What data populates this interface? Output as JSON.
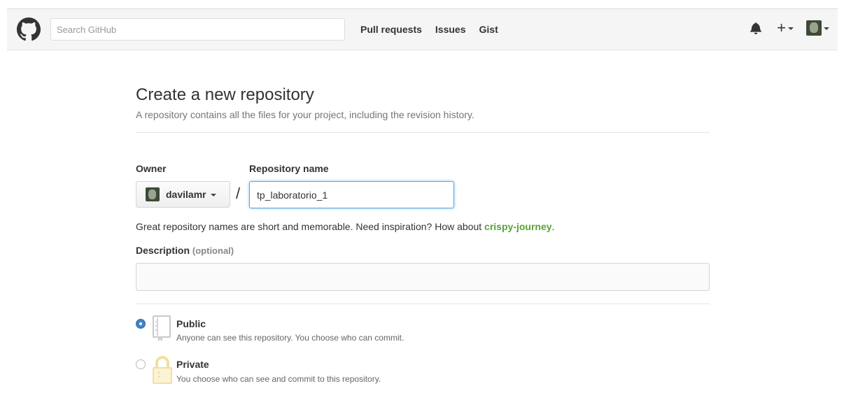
{
  "header": {
    "search_placeholder": "Search GitHub",
    "nav": [
      "Pull requests",
      "Issues",
      "Gist"
    ],
    "icons": {
      "logo": "octocat-icon",
      "notifications": "bell-icon",
      "create": "plus-icon"
    }
  },
  "page": {
    "title": "Create a new repository",
    "subtitle": "A repository contains all the files for your project, including the revision history."
  },
  "form": {
    "owner_label": "Owner",
    "owner_value": "davilamr",
    "slash": "/",
    "repo_label": "Repository name",
    "repo_value": "tp_laboratorio_1",
    "hint_text": "Great repository names are short and memorable. Need inspiration? How about ",
    "hint_suggestion": "crispy-journey",
    "hint_end": ".",
    "description_label": "Description",
    "description_optional": "(optional)",
    "description_value": ""
  },
  "visibility": {
    "options": [
      {
        "title": "Public",
        "description": "Anyone can see this repository. You choose who can commit.",
        "selected": true
      },
      {
        "title": "Private",
        "description": "You choose who can see and commit to this repository.",
        "selected": false
      }
    ]
  },
  "colors": {
    "accent": "#4183c4",
    "suggestion": "#55a532",
    "focus": "#51a7e8",
    "lock": "#f2e0a0"
  }
}
